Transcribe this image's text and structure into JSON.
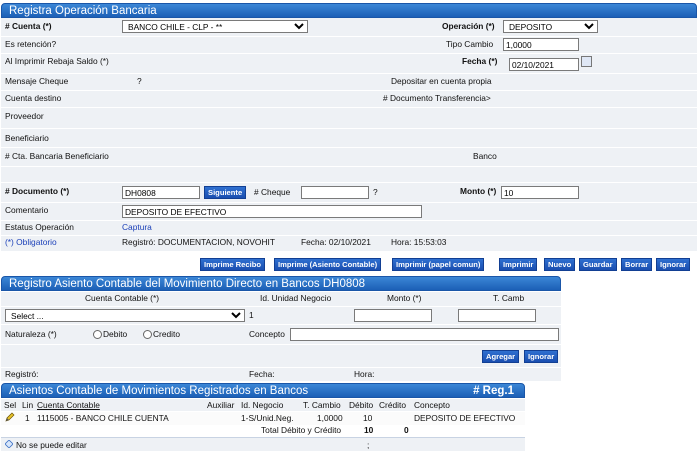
{
  "form": {
    "title": "Registra Operación Bancaria",
    "cuenta_label": "# Cuenta (*)",
    "cuenta_value": "BANCO CHILE - CLP - **",
    "operacion_label": "Operación (*)",
    "operacion_value": "DEPOSITO",
    "es_retencion_label": "Es retención?",
    "tipo_cambio_label": "Tipo Cambio",
    "tipo_cambio_value": "1,0000",
    "rebaja_label": "Al Imprimir Rebaja Saldo (*)",
    "fecha_label": "Fecha (*)",
    "fecha_value": "02/10/2021",
    "mensaje_cheque_label": "Mensaje Cheque",
    "mensaje_cheque_value": "?",
    "depositar_label": "Depositar en cuenta propia",
    "cuenta_destino_label": "Cuenta destino",
    "doc_transferencia_label": "# Documento Transferencia>",
    "proveedor_label": "Proveedor",
    "beneficiario_label": "Beneficiario",
    "cta_bancaria_label": "# Cta. Bancaria Beneficiario",
    "banco_label": "Banco",
    "documento_label": "# Documento (*)",
    "documento_value": "DH0808",
    "siguiente_label": "Siguiente",
    "cheque_label": "# Cheque",
    "cheque_help": "?",
    "monto_label": "Monto (*)",
    "monto_value": "10",
    "comentario_label": "Comentario",
    "comentario_value": "DEPOSITO DE EFECTIVO",
    "estatus_label": "Estatus Operación",
    "estatus_value": "Captura",
    "obligatorio_label": "(*) Obligatorio",
    "registro_text": "Registró: DOCUMENTACION, NOVOHIT",
    "fecha_reg_text": "Fecha: 02/10/2021",
    "hora_text": "Hora: 15:53:03",
    "buttons": {
      "imprime_recibo": "Imprime Recibo",
      "imprime_asiento": "Imprime (Asiento Contable)",
      "imprimir_papel": "Imprimir (papel comun)",
      "imprimir": "Imprimir",
      "nuevo": "Nuevo",
      "guardar": "Guardar",
      "borrar": "Borrar",
      "ignorar": "Ignorar"
    }
  },
  "asiento": {
    "title": "Registro Asiento Contable del Movimiento Directo en Bancos DH0808",
    "col_cuenta": "Cuenta Contable (*)",
    "col_unidad": "Id. Unidad Negocio",
    "col_monto": "Monto (*)",
    "col_tcamb": "T. Camb",
    "select_placeholder": "Select ...",
    "unidad_value": "1",
    "naturaleza_label": "Naturaleza (*)",
    "debito_label": "Debito",
    "credito_label": "Credito",
    "concepto_label": "Concepto",
    "agregar_label": "Agregar",
    "ignorar_label": "Ignorar",
    "registro_label": "Registró:",
    "fecha_label": "Fecha:",
    "hora_label": "Hora:"
  },
  "movimientos": {
    "title": "Asientos Contable de Movimientos Registrados en Bancos",
    "reg_count": "# Reg.1",
    "headers": [
      "Sel",
      "Lin",
      "Cuenta Contable",
      "Auxiliar",
      "Id. Negocio",
      "T. Cambio",
      "Débito",
      "Crédito",
      "Concepto"
    ],
    "row": {
      "lin": "1",
      "cuenta": "1115005 - BANCO CHILE CUENTA",
      "auxiliar": "",
      "negocio": "1-S/Unid.Neg.",
      "tcambio": "1,0000",
      "debito": "10",
      "credito": "",
      "concepto": "DEPOSITO DE EFECTIVO"
    },
    "total_label": "Total Débito y Crédito",
    "total_debito": "10",
    "total_credito": "0",
    "footer_note": "No se puede editar",
    "footer_sep": ";"
  }
}
